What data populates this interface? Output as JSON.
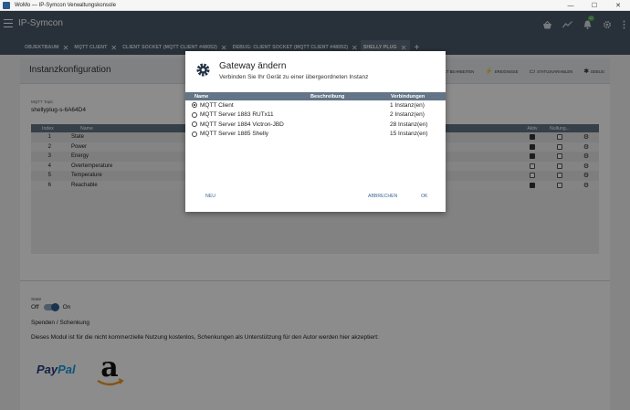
{
  "window": {
    "title": "WoMo — IP-Symcon Verwaltungskonsole",
    "controls": [
      "—",
      "☐",
      "✕"
    ]
  },
  "app": {
    "title": "IP-Symcon",
    "notification_count": "12"
  },
  "tabs": [
    {
      "label": "OBJEKTBAUM",
      "active": false
    },
    {
      "label": "MQTT CLIENT",
      "active": false
    },
    {
      "label": "CLIENT SOCKET (MQTT CLIENT #48052)",
      "active": false
    },
    {
      "label": "DEBUG: CLIENT SOCKET (MQTT CLIENT #48052)",
      "active": false
    },
    {
      "label": "SHELLY PLUG",
      "active": true
    }
  ],
  "panel": {
    "title": "Instanzkonfiguration",
    "actions": {
      "edit": "OBJEKT BEARBEITEN",
      "events": "EREIGNISSE",
      "statusvars": "STATUSVARIABLEN",
      "debug": "DEBUG"
    },
    "topic_label": "MQTT Topic",
    "topic_value": "shellyplug-s-6A64D4",
    "table": {
      "headers": {
        "index": "Index",
        "name": "Name",
        "aktiv": "Aktiv",
        "null": "Nullung..."
      },
      "rows": [
        {
          "index": "1",
          "name": "State",
          "aktiv": true,
          "null": false
        },
        {
          "index": "2",
          "name": "Power",
          "aktiv": true,
          "null": false
        },
        {
          "index": "3",
          "name": "Energy",
          "aktiv": true,
          "null": false
        },
        {
          "index": "4",
          "name": "Overtemperature",
          "aktiv": false,
          "null": false
        },
        {
          "index": "5",
          "name": "Temperature",
          "aktiv": false,
          "null": false
        },
        {
          "index": "6",
          "name": "Reachable",
          "aktiv": true,
          "null": false
        }
      ]
    },
    "state_label": "State",
    "switch_off": "Off",
    "switch_on": "On",
    "spenden": "Spenden / Schenkung",
    "modul_text": "Dieses Modul ist für die nicht kommerzielle Nutzung kostenlos, Schenkungen als Unterstützung für den Autor werden hier akzeptiert:",
    "paypal_pay": "Pay",
    "paypal_pal": "Pal"
  },
  "dialog": {
    "title": "Gateway ändern",
    "subtitle": "Verbinden Sie Ihr Gerät zu einer übergeordneten Instanz",
    "headers": {
      "name": "Name",
      "desc": "Beschreibung",
      "conn": "Verbindungen"
    },
    "rows": [
      {
        "name": "MQTT Client",
        "conn": "1 Instanz(en)",
        "selected": true
      },
      {
        "name": "MQTT Server 1883 RUTx11",
        "conn": "2 Instanz(en)",
        "selected": false
      },
      {
        "name": "MQTT Server 1884 Victron-JBD",
        "conn": "28 Instanz(en)",
        "selected": false
      },
      {
        "name": "MQTT Server 1885 Shelly",
        "conn": "15 Instanz(en)",
        "selected": false
      }
    ],
    "btn_new": "NEU",
    "btn_cancel": "ABBRECHEN",
    "btn_ok": "OK"
  }
}
